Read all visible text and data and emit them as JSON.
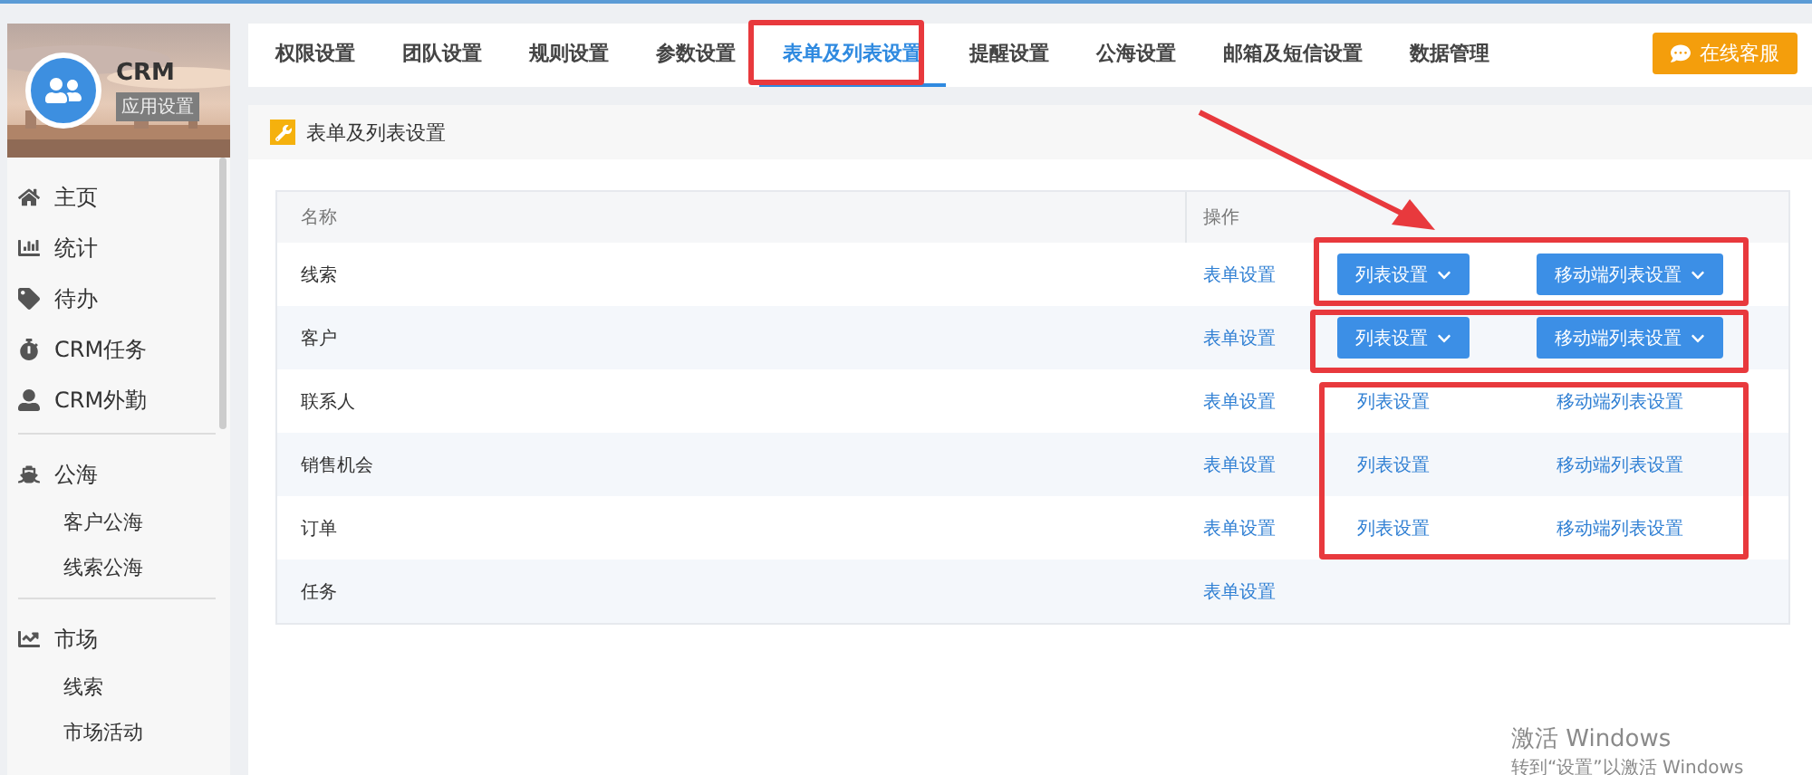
{
  "app": {
    "name": "CRM",
    "badge": "应用设置"
  },
  "sidebar": {
    "groups": [
      {
        "items": [
          {
            "label": "主页"
          },
          {
            "label": "统计"
          },
          {
            "label": "待办"
          },
          {
            "label": "CRM任务"
          },
          {
            "label": "CRM外勤"
          }
        ]
      },
      {
        "items": [
          {
            "label": "公海",
            "children": [
              {
                "label": "客户公海"
              },
              {
                "label": "线索公海"
              }
            ]
          }
        ]
      },
      {
        "items": [
          {
            "label": "市场",
            "children": [
              {
                "label": "线索"
              },
              {
                "label": "市场活动"
              }
            ]
          }
        ]
      }
    ]
  },
  "tabs": [
    {
      "label": "权限设置",
      "selected": false
    },
    {
      "label": "团队设置",
      "selected": false
    },
    {
      "label": "规则设置",
      "selected": false
    },
    {
      "label": "参数设置",
      "selected": false
    },
    {
      "label": "表单及列表设置",
      "selected": true
    },
    {
      "label": "提醒设置",
      "selected": false
    },
    {
      "label": "公海设置",
      "selected": false
    },
    {
      "label": "邮箱及短信设置",
      "selected": false
    },
    {
      "label": "数据管理",
      "selected": false
    }
  ],
  "support_button": "在线客服",
  "panel": {
    "title": "表单及列表设置"
  },
  "table": {
    "columns": [
      "名称",
      "操作"
    ],
    "rows": [
      {
        "name": "线索",
        "kind": "dropdown",
        "form": "表单设置",
        "list": "列表设置",
        "mobile": "移动端列表设置"
      },
      {
        "name": "客户",
        "kind": "dropdown",
        "form": "表单设置",
        "list": "列表设置",
        "mobile": "移动端列表设置"
      },
      {
        "name": "联系人",
        "kind": "link",
        "form": "表单设置",
        "list": "列表设置",
        "mobile": "移动端列表设置"
      },
      {
        "name": "销售机会",
        "kind": "link",
        "form": "表单设置",
        "list": "列表设置",
        "mobile": "移动端列表设置"
      },
      {
        "name": "订单",
        "kind": "link",
        "form": "表单设置",
        "list": "列表设置",
        "mobile": "移动端列表设置"
      },
      {
        "name": "任务",
        "kind": "none",
        "form": "表单设置"
      }
    ]
  },
  "os_overlay": {
    "title": "激活 Windows",
    "hint": "转到“设置”以激活 Windows"
  }
}
